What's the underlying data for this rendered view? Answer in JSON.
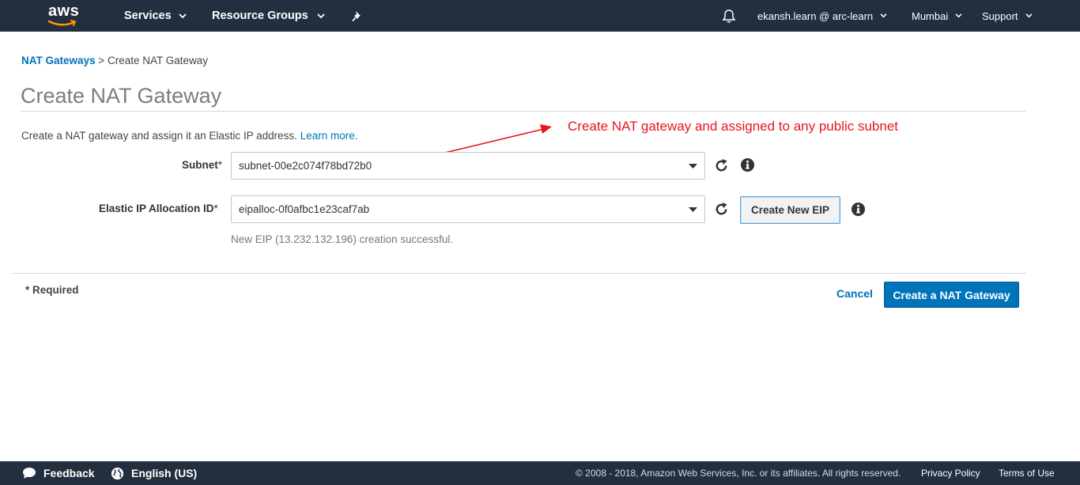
{
  "topnav": {
    "logo_text": "aws",
    "services": "Services",
    "resource_groups": "Resource Groups",
    "pin_icon": "pin-icon",
    "bell_icon": "bell-icon",
    "account": "ekansh.learn @ arc-learn",
    "region": "Mumbai",
    "support": "Support"
  },
  "breadcrumb": {
    "parent": "NAT Gateways",
    "separator": ">",
    "current": "Create NAT Gateway"
  },
  "page": {
    "title": "Create NAT Gateway",
    "description": "Create a NAT gateway and assign it an Elastic IP address.",
    "learn_more": "Learn more."
  },
  "annotation": {
    "text": "Create NAT gateway and assigned to any public subnet",
    "color": "#e8141f"
  },
  "form": {
    "subnet": {
      "label": "Subnet",
      "required_mark": "*",
      "value": "subnet-00e2c074f78bd72b0"
    },
    "eip": {
      "label": "Elastic IP Allocation ID",
      "required_mark": "*",
      "value": "eipalloc-0f0afbc1e23caf7ab",
      "create_button": "Create New EIP",
      "success_message": "New EIP (13.232.132.196) creation successful."
    }
  },
  "footer_actions": {
    "required_note": "* Required",
    "cancel": "Cancel",
    "submit": "Create a NAT Gateway"
  },
  "bottombar": {
    "feedback": "Feedback",
    "language": "English (US)",
    "copyright": "© 2008 - 2018, Amazon Web Services, Inc. or its affiliates. All rights reserved.",
    "privacy": "Privacy Policy",
    "terms": "Terms of Use"
  },
  "colors": {
    "nav_bg": "#232f3e",
    "link": "#0073bb",
    "primary_button": "#0073bb",
    "logo_smile": "#ff9900"
  }
}
